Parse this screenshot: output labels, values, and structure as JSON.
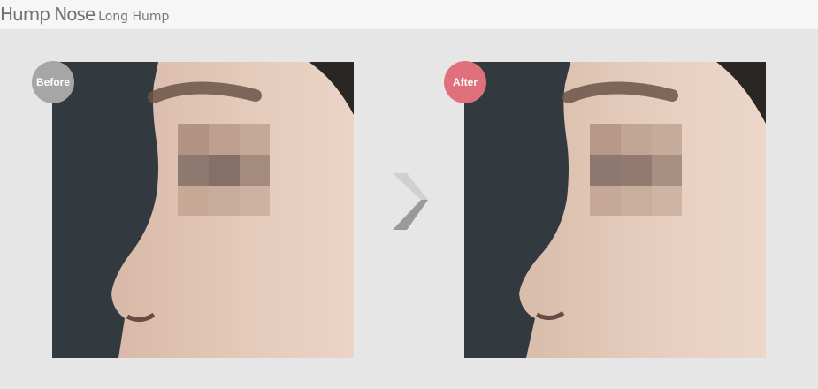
{
  "header": {
    "title": "Hump Nose",
    "subtitle": "Long Hump"
  },
  "before": {
    "badge_label": "Before",
    "badge_color": "#a6a6a6"
  },
  "after": {
    "badge_label": "After",
    "badge_color": "#e0707c"
  },
  "arrow_icon": "chevron-right-icon"
}
